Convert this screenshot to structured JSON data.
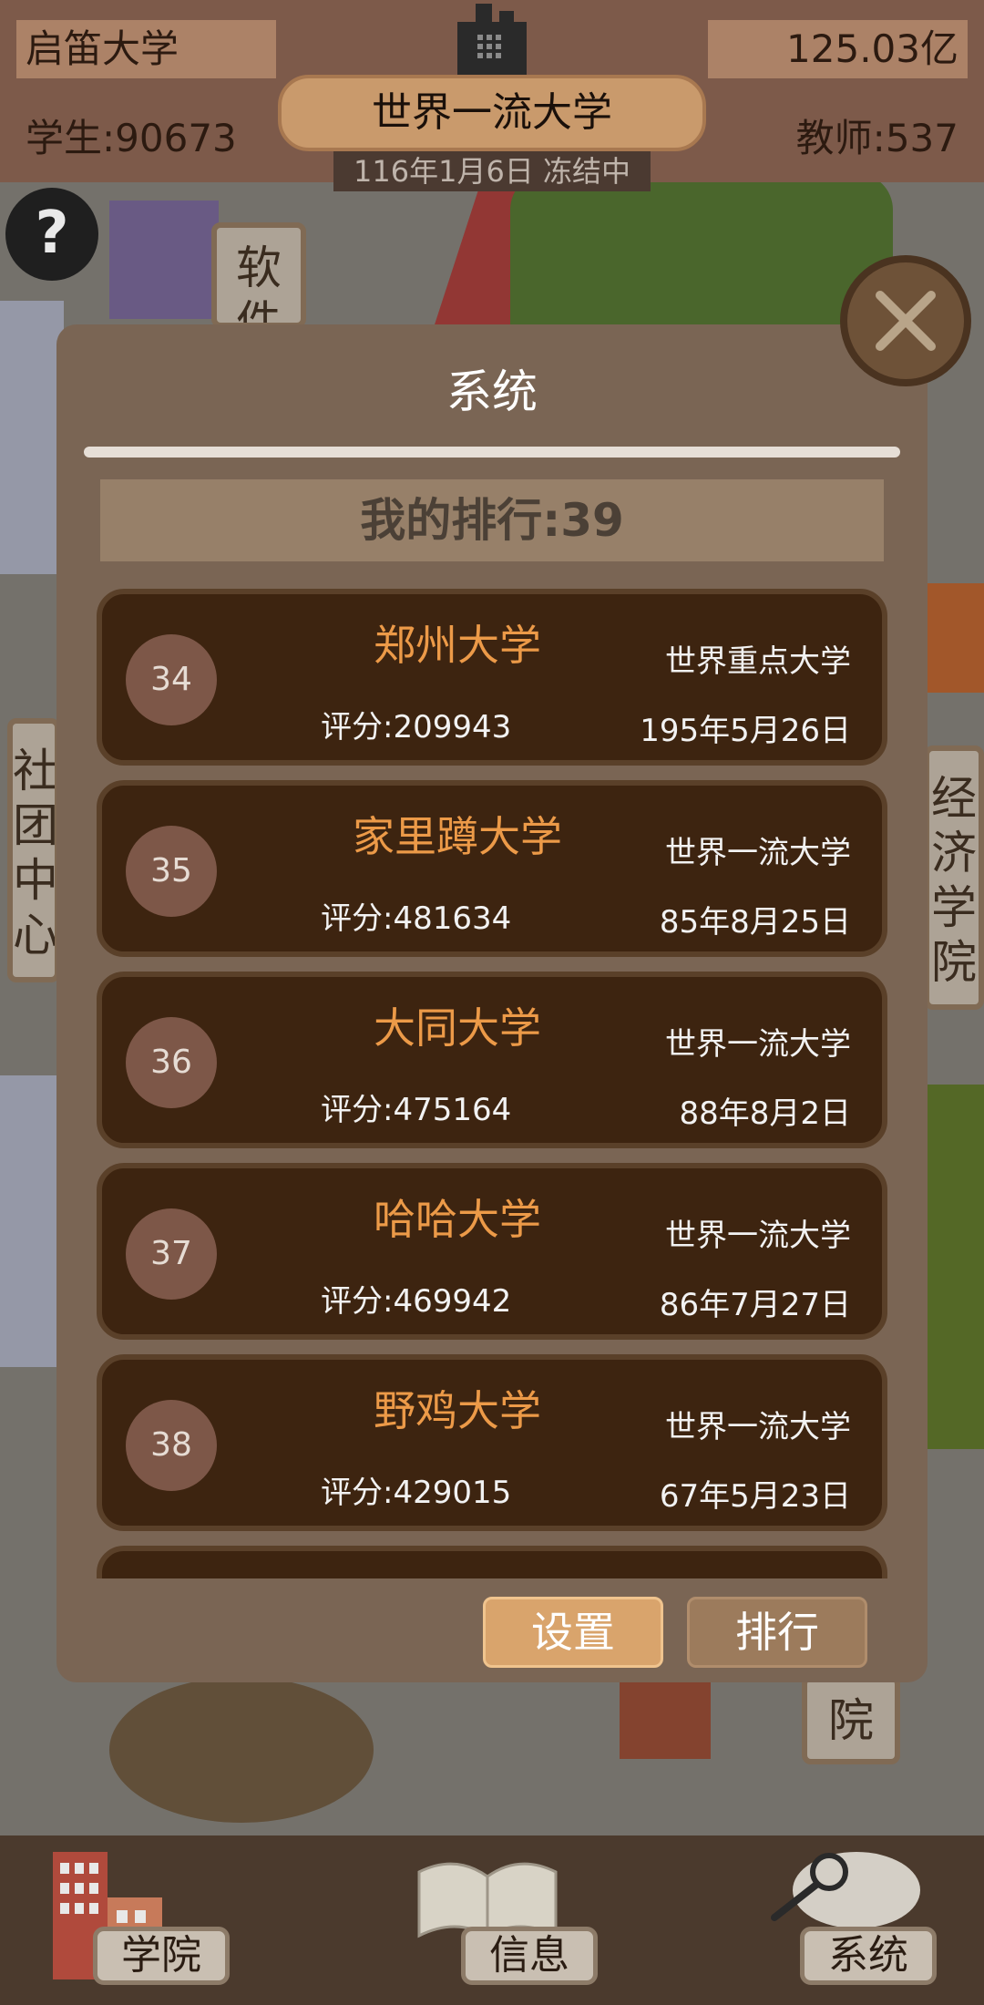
{
  "hud": {
    "university_name": "启笛大学",
    "money": "125.03亿",
    "students": "学生:90673",
    "teachers": "教师:537",
    "rank_title": "世界一流大学",
    "date_status": "116年1月6日 冻结中"
  },
  "help_button": "?",
  "background_signs": {
    "software": "软\n件",
    "community": "社\n团\n中\n心",
    "economics": "经\n济\n学\n院",
    "right_top": "",
    "bottom": "院"
  },
  "dialog": {
    "title": "系统",
    "my_rank": "我的排行:39",
    "rows": [
      {
        "rank": "34",
        "name": "郑州大学",
        "score": "评分:209943",
        "level": "世界重点大学",
        "date": "195年5月26日"
      },
      {
        "rank": "35",
        "name": "家里蹲大学",
        "score": "评分:481634",
        "level": "世界一流大学",
        "date": "85年8月25日"
      },
      {
        "rank": "36",
        "name": "大同大学",
        "score": "评分:475164",
        "level": "世界一流大学",
        "date": "88年8月2日"
      },
      {
        "rank": "37",
        "name": "哈哈大学",
        "score": "评分:469942",
        "level": "世界一流大学",
        "date": "86年7月27日"
      },
      {
        "rank": "38",
        "name": "野鸡大学",
        "score": "评分:429015",
        "level": "世界一流大学",
        "date": "67年5月23日"
      }
    ],
    "buttons": {
      "settings": "设置",
      "ranking": "排行"
    }
  },
  "bottom_nav": [
    {
      "label": "学院",
      "icon": "college-building-icon"
    },
    {
      "label": "信息",
      "icon": "open-book-icon"
    },
    {
      "label": "系统",
      "icon": "magnifier-icon"
    }
  ]
}
